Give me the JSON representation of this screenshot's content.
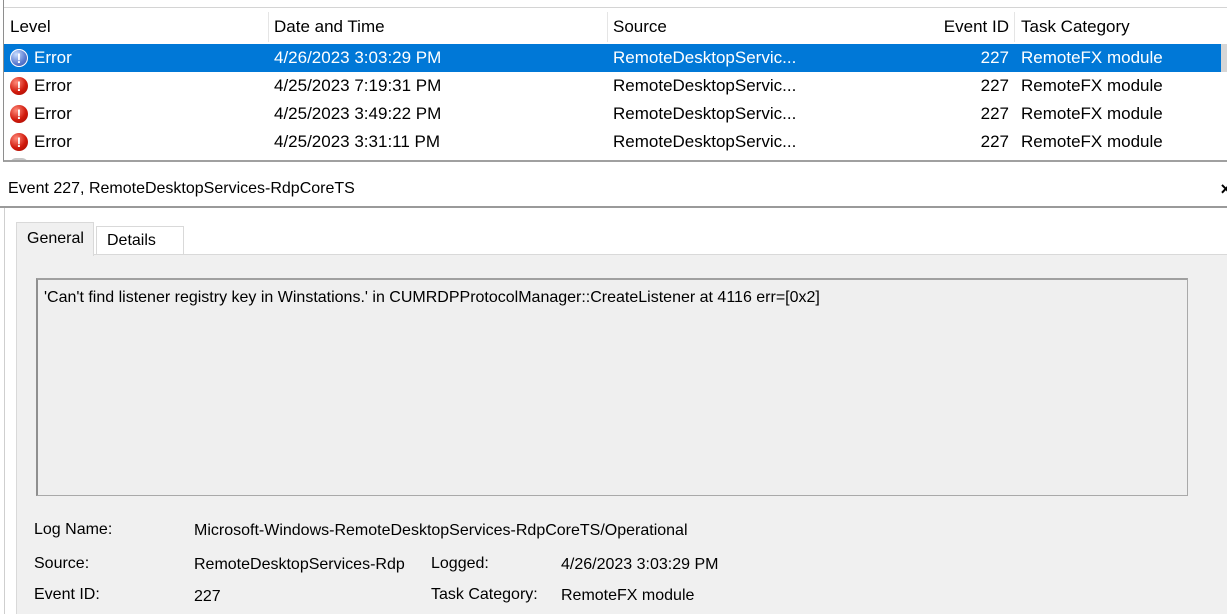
{
  "grid": {
    "columns": {
      "level": "Level",
      "date_time": "Date and Time",
      "source": "Source",
      "event_id": "Event ID",
      "task_category": "Task Category"
    },
    "rows": [
      {
        "level": "Error",
        "date_time": "4/26/2023 3:03:29 PM",
        "source": "RemoteDesktopServic...",
        "event_id": "227",
        "task_category": "RemoteFX module",
        "selected": true
      },
      {
        "level": "Error",
        "date_time": "4/25/2023 7:19:31 PM",
        "source": "RemoteDesktopServic...",
        "event_id": "227",
        "task_category": "RemoteFX module",
        "selected": false
      },
      {
        "level": "Error",
        "date_time": "4/25/2023 3:49:22 PM",
        "source": "RemoteDesktopServic...",
        "event_id": "227",
        "task_category": "RemoteFX module",
        "selected": false
      },
      {
        "level": "Error",
        "date_time": "4/25/2023 3:31:11 PM",
        "source": "RemoteDesktopServic...",
        "event_id": "227",
        "task_category": "RemoteFX module",
        "selected": false
      }
    ],
    "icons": {
      "error": "error-icon",
      "selected_error": "error-icon-selected"
    },
    "colors": {
      "selection": "#0078d7",
      "error_red": "#d11a0c"
    }
  },
  "detail": {
    "title": "Event 227, RemoteDesktopServices-RdpCoreTS",
    "close_glyph": "×",
    "tabs": {
      "general": "General",
      "details": "Details"
    },
    "message": "'Can't find listener registry key in Winstations.' in CUMRDPProtocolManager::CreateListener at 4116 err=[0x2]",
    "properties": {
      "log_name_label": "Log Name:",
      "log_name_value": "Microsoft-Windows-RemoteDesktopServices-RdpCoreTS/Operational",
      "source_label": "Source:",
      "source_value": "RemoteDesktopServices-Rdp",
      "logged_label": "Logged:",
      "logged_value": "4/26/2023 3:03:29 PM",
      "event_id_label": "Event ID:",
      "event_id_value": "227",
      "task_category_label": "Task Category:",
      "task_category_value": "RemoteFX module"
    }
  }
}
